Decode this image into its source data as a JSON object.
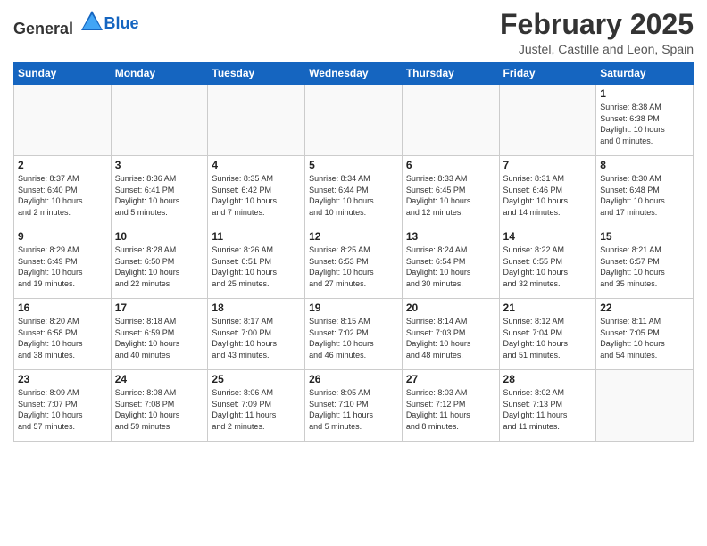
{
  "header": {
    "logo_general": "General",
    "logo_blue": "Blue",
    "title": "February 2025",
    "location": "Justel, Castille and Leon, Spain"
  },
  "weekdays": [
    "Sunday",
    "Monday",
    "Tuesday",
    "Wednesday",
    "Thursday",
    "Friday",
    "Saturday"
  ],
  "weeks": [
    [
      {
        "day": "",
        "info": ""
      },
      {
        "day": "",
        "info": ""
      },
      {
        "day": "",
        "info": ""
      },
      {
        "day": "",
        "info": ""
      },
      {
        "day": "",
        "info": ""
      },
      {
        "day": "",
        "info": ""
      },
      {
        "day": "1",
        "info": "Sunrise: 8:38 AM\nSunset: 6:38 PM\nDaylight: 10 hours\nand 0 minutes."
      }
    ],
    [
      {
        "day": "2",
        "info": "Sunrise: 8:37 AM\nSunset: 6:40 PM\nDaylight: 10 hours\nand 2 minutes."
      },
      {
        "day": "3",
        "info": "Sunrise: 8:36 AM\nSunset: 6:41 PM\nDaylight: 10 hours\nand 5 minutes."
      },
      {
        "day": "4",
        "info": "Sunrise: 8:35 AM\nSunset: 6:42 PM\nDaylight: 10 hours\nand 7 minutes."
      },
      {
        "day": "5",
        "info": "Sunrise: 8:34 AM\nSunset: 6:44 PM\nDaylight: 10 hours\nand 10 minutes."
      },
      {
        "day": "6",
        "info": "Sunrise: 8:33 AM\nSunset: 6:45 PM\nDaylight: 10 hours\nand 12 minutes."
      },
      {
        "day": "7",
        "info": "Sunrise: 8:31 AM\nSunset: 6:46 PM\nDaylight: 10 hours\nand 14 minutes."
      },
      {
        "day": "8",
        "info": "Sunrise: 8:30 AM\nSunset: 6:48 PM\nDaylight: 10 hours\nand 17 minutes."
      }
    ],
    [
      {
        "day": "9",
        "info": "Sunrise: 8:29 AM\nSunset: 6:49 PM\nDaylight: 10 hours\nand 19 minutes."
      },
      {
        "day": "10",
        "info": "Sunrise: 8:28 AM\nSunset: 6:50 PM\nDaylight: 10 hours\nand 22 minutes."
      },
      {
        "day": "11",
        "info": "Sunrise: 8:26 AM\nSunset: 6:51 PM\nDaylight: 10 hours\nand 25 minutes."
      },
      {
        "day": "12",
        "info": "Sunrise: 8:25 AM\nSunset: 6:53 PM\nDaylight: 10 hours\nand 27 minutes."
      },
      {
        "day": "13",
        "info": "Sunrise: 8:24 AM\nSunset: 6:54 PM\nDaylight: 10 hours\nand 30 minutes."
      },
      {
        "day": "14",
        "info": "Sunrise: 8:22 AM\nSunset: 6:55 PM\nDaylight: 10 hours\nand 32 minutes."
      },
      {
        "day": "15",
        "info": "Sunrise: 8:21 AM\nSunset: 6:57 PM\nDaylight: 10 hours\nand 35 minutes."
      }
    ],
    [
      {
        "day": "16",
        "info": "Sunrise: 8:20 AM\nSunset: 6:58 PM\nDaylight: 10 hours\nand 38 minutes."
      },
      {
        "day": "17",
        "info": "Sunrise: 8:18 AM\nSunset: 6:59 PM\nDaylight: 10 hours\nand 40 minutes."
      },
      {
        "day": "18",
        "info": "Sunrise: 8:17 AM\nSunset: 7:00 PM\nDaylight: 10 hours\nand 43 minutes."
      },
      {
        "day": "19",
        "info": "Sunrise: 8:15 AM\nSunset: 7:02 PM\nDaylight: 10 hours\nand 46 minutes."
      },
      {
        "day": "20",
        "info": "Sunrise: 8:14 AM\nSunset: 7:03 PM\nDaylight: 10 hours\nand 48 minutes."
      },
      {
        "day": "21",
        "info": "Sunrise: 8:12 AM\nSunset: 7:04 PM\nDaylight: 10 hours\nand 51 minutes."
      },
      {
        "day": "22",
        "info": "Sunrise: 8:11 AM\nSunset: 7:05 PM\nDaylight: 10 hours\nand 54 minutes."
      }
    ],
    [
      {
        "day": "23",
        "info": "Sunrise: 8:09 AM\nSunset: 7:07 PM\nDaylight: 10 hours\nand 57 minutes."
      },
      {
        "day": "24",
        "info": "Sunrise: 8:08 AM\nSunset: 7:08 PM\nDaylight: 10 hours\nand 59 minutes."
      },
      {
        "day": "25",
        "info": "Sunrise: 8:06 AM\nSunset: 7:09 PM\nDaylight: 11 hours\nand 2 minutes."
      },
      {
        "day": "26",
        "info": "Sunrise: 8:05 AM\nSunset: 7:10 PM\nDaylight: 11 hours\nand 5 minutes."
      },
      {
        "day": "27",
        "info": "Sunrise: 8:03 AM\nSunset: 7:12 PM\nDaylight: 11 hours\nand 8 minutes."
      },
      {
        "day": "28",
        "info": "Sunrise: 8:02 AM\nSunset: 7:13 PM\nDaylight: 11 hours\nand 11 minutes."
      },
      {
        "day": "",
        "info": ""
      }
    ]
  ]
}
